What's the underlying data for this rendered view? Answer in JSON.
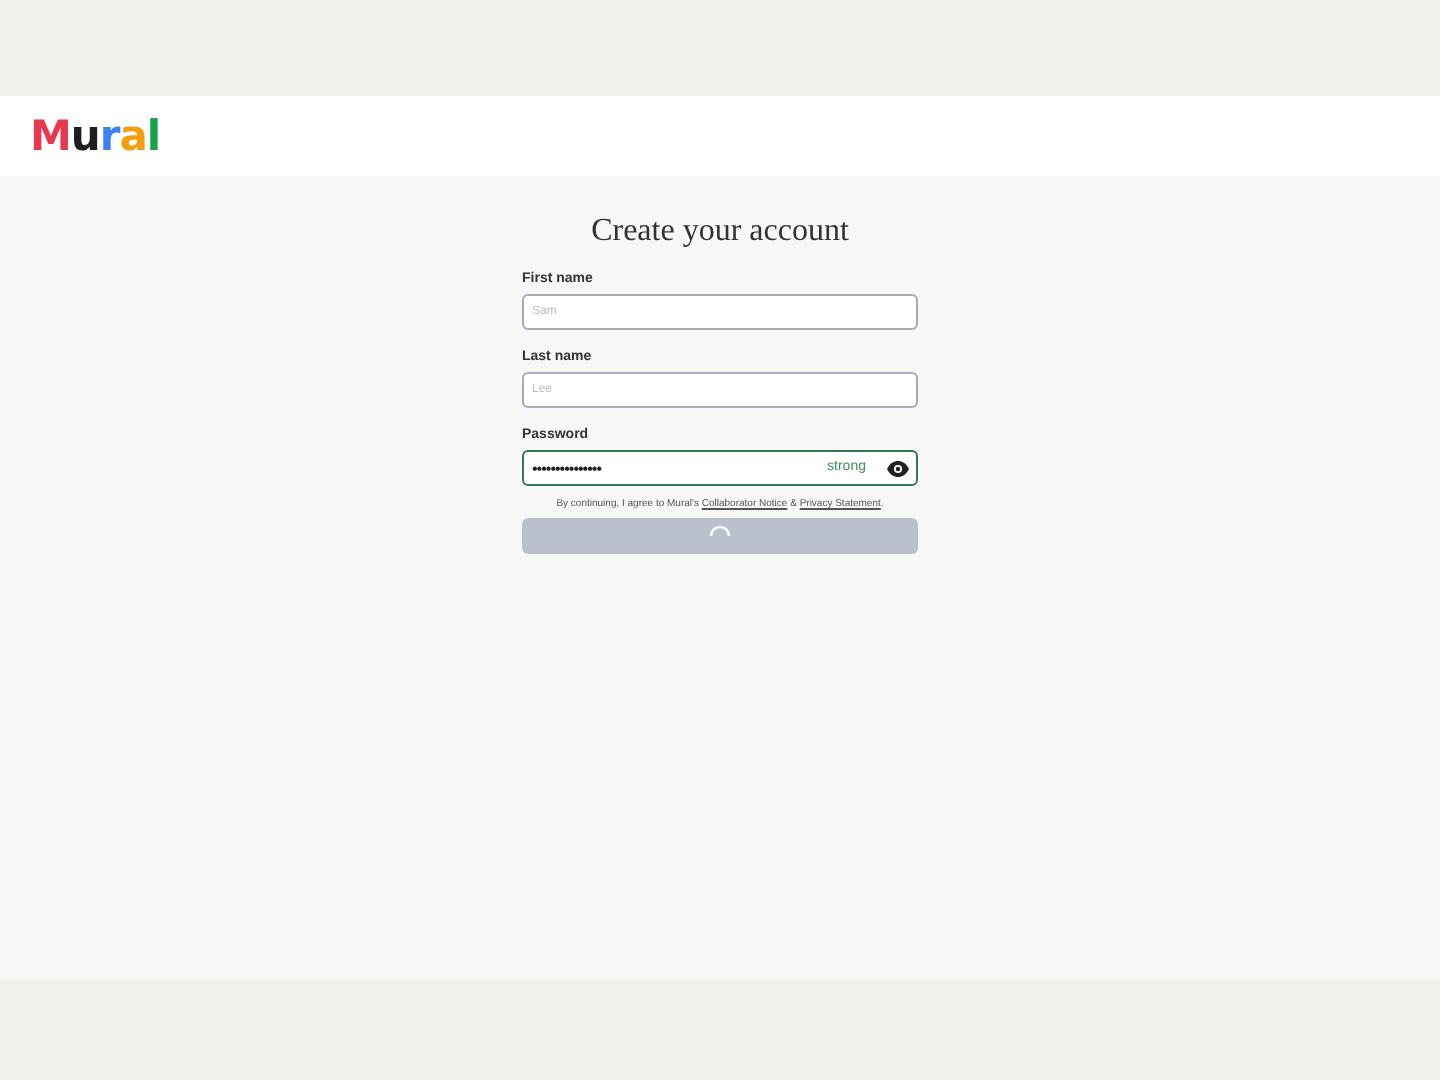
{
  "header": {
    "logo": "Mural"
  },
  "form": {
    "title": "Create your account",
    "fields": [
      {
        "kind": "text",
        "label": "First name",
        "placeholder": "Sam",
        "valid": false
      },
      {
        "kind": "text",
        "label": "Last name",
        "placeholder": "Lee",
        "valid": false
      },
      {
        "kind": "password",
        "label": "Password",
        "value": "•••••••••••••••",
        "strength": "strong",
        "valid": true
      }
    ],
    "consent": {
      "text": "By continuing, I agree to Mural's",
      "link1": "Collaborator Notice",
      "joiner": "&",
      "link2": "Privacy Statement",
      "end": "."
    },
    "submit": {
      "loading": true,
      "disabled": true
    }
  }
}
